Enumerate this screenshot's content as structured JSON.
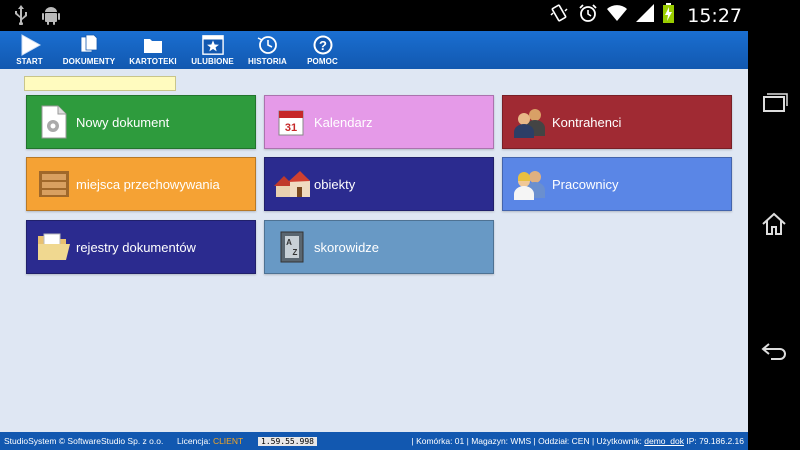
{
  "statusbar": {
    "time": "15:27",
    "icons": [
      "usb-icon",
      "android-icon",
      "vibrate-icon",
      "alarm-icon",
      "wifi-icon",
      "signal-icon",
      "battery-charging-icon"
    ]
  },
  "toolbar": {
    "items": [
      {
        "label": "START",
        "icon": "play-icon"
      },
      {
        "label": "DOKUMENTY",
        "icon": "documents-icon"
      },
      {
        "label": "KARTOTEKI",
        "icon": "folder-icon"
      },
      {
        "label": "ULUBIONE",
        "icon": "star-icon"
      },
      {
        "label": "HISTORIA",
        "icon": "history-icon"
      },
      {
        "label": "POMOC",
        "icon": "help-icon"
      }
    ]
  },
  "search": {
    "value": "",
    "placeholder": ""
  },
  "tiles": [
    {
      "label": "Nowy dokument",
      "color": "#2e9b3d",
      "icon": "new-document-icon"
    },
    {
      "label": "Kalendarz",
      "color": "#e59ae8",
      "icon": "calendar-icon"
    },
    {
      "label": "Kontrahenci",
      "color": "#a02a33",
      "icon": "contractors-icon"
    },
    {
      "label": "miejsca przechowywania",
      "color": "#f5a234",
      "icon": "shelf-icon"
    },
    {
      "label": "obiekty",
      "color": "#2b2b8f",
      "icon": "houses-icon"
    },
    {
      "label": "Pracownicy",
      "color": "#5a86e6",
      "icon": "employees-icon"
    },
    {
      "label": "rejestry dokumentów",
      "color": "#2b2b8f",
      "icon": "open-folder-icon"
    },
    {
      "label": "skorowidze",
      "color": "#6899c5",
      "icon": "index-book-icon"
    }
  ],
  "footer": {
    "copyright": "StudioSystem © SoftwareStudio Sp. z o.o.",
    "license_label": "Licencja:",
    "license_value": "CLIENT",
    "version": "1.59.55.998",
    "right_prefix": "| Komórka: 01 | Magazyn: WMS | Oddział: CEN | Użytkownik:",
    "user": "demo_dok",
    "ip": "IP: 79.186.2.16"
  },
  "navbar": {
    "icons": [
      "recent-apps-icon",
      "home-icon",
      "back-icon"
    ]
  },
  "colors": {
    "toolbar": "#1565c0",
    "background": "#dfe7f3",
    "search_bg": "#fffbbf"
  }
}
